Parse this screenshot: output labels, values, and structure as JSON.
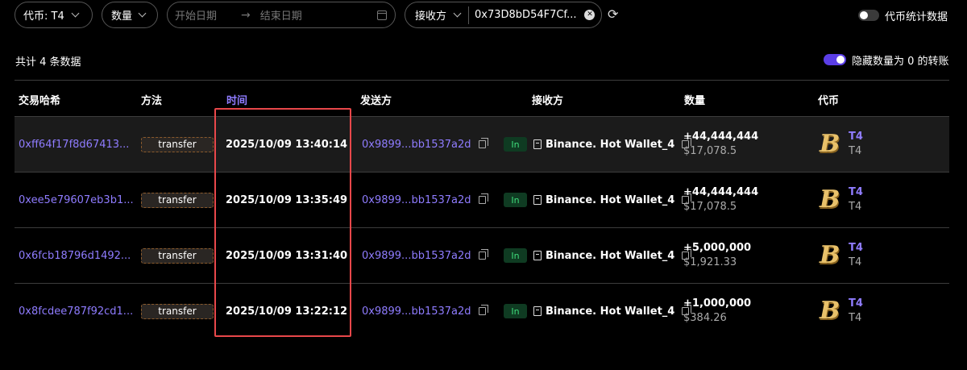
{
  "filters": {
    "token_label": "代币: T4",
    "amount_label": "数量",
    "date_start_placeholder": "开始日期",
    "date_end_placeholder": "结束日期",
    "receiver_label": "接收方",
    "receiver_value": "0x73D8bD54F7Cf..."
  },
  "toggles": {
    "token_stats": {
      "label": "代币统计数据",
      "on": false
    },
    "hide_zero": {
      "label": "隐藏数量为 0 的转账",
      "on": true,
      "color": "#5b3ee6"
    }
  },
  "summary": {
    "total": "共计 4 条数据"
  },
  "table": {
    "headers": {
      "hash": "交易哈希",
      "method": "方法",
      "time": "时间",
      "from": "发送方",
      "to": "接收方",
      "amount": "数量",
      "token": "代币"
    },
    "rows": [
      {
        "hash": "0xff64f17f8d67413...",
        "method": "transfer",
        "time": "2025/10/09 13:40:14",
        "from": "0x9899...bb1537a2d",
        "direction": "In",
        "to": "Binance. Hot Wallet_4",
        "amount": "+44,444,444",
        "usd": "$17,078.5",
        "token_symbol": "T4",
        "token_name": "T4"
      },
      {
        "hash": "0xee5e79607eb3b1...",
        "method": "transfer",
        "time": "2025/10/09 13:35:49",
        "from": "0x9899...bb1537a2d",
        "direction": "In",
        "to": "Binance. Hot Wallet_4",
        "amount": "+44,444,444",
        "usd": "$17,078.5",
        "token_symbol": "T4",
        "token_name": "T4"
      },
      {
        "hash": "0x6fcb18796d1492...",
        "method": "transfer",
        "time": "2025/10/09 13:31:40",
        "from": "0x9899...bb1537a2d",
        "direction": "In",
        "to": "Binance. Hot Wallet_4",
        "amount": "+5,000,000",
        "usd": "$1,921.33",
        "token_symbol": "T4",
        "token_name": "T4"
      },
      {
        "hash": "0x8fcdee787f92cd1...",
        "method": "transfer",
        "time": "2025/10/09 13:22:12",
        "from": "0x9899...bb1537a2d",
        "direction": "In",
        "to": "Binance. Hot Wallet_4",
        "amount": "+1,000,000",
        "usd": "$384.26",
        "token_symbol": "T4",
        "token_name": "T4"
      }
    ]
  },
  "colors": {
    "accent": "#8f7cff",
    "in_badge": "#3fdc7b",
    "highlight_box": "#e8474a"
  }
}
